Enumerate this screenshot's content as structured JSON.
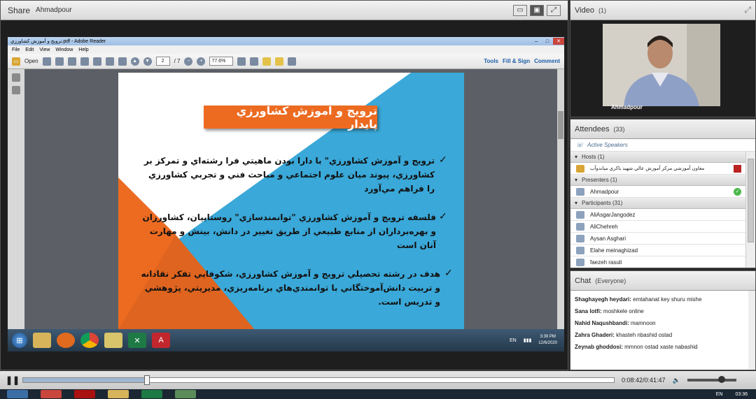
{
  "share": {
    "title": "Share",
    "presenter": "Ahmadpour"
  },
  "reader": {
    "window_title": "ترويج و آموزش كشاورزي.pdf - Adobe Reader",
    "menu": [
      "File",
      "Edit",
      "View",
      "Window",
      "Help"
    ],
    "open_label": "Open",
    "page_current": "2",
    "page_total": "/ 7",
    "zoom": "77.6%",
    "tools": "Tools",
    "fill_sign": "Fill & Sign",
    "comment": "Comment"
  },
  "slide": {
    "title": "ترويج و آموزش كشاورزي پايدار",
    "bullets": [
      "ترويج و آموزش كشاورزي\" با دارا بودن ماهيتي فرا رشته‌اي و تمركز بر كشاورزي، پيوند ميان علوم اجتماعي و مباحث فني و تجربي كشاورزي را فراهم مي‌آورد",
      "فلسفه ترويج و آموزش كشاورزي \"توانمندسازي\" روستاييان، كشاورزان و بهره‌برداران از منابع طبيعي از طريق تغيير در دانش، بينش و مهارت آنان است",
      "هدف در رشته تحصيلي ترويج و آموزش كشاورزي، شكوفايي تفكر نقادانه و تربيت دانش‌آموختگاني با توانمندي‌هاي برنامه‌ريزي، مديريتي، پژوهشي و تدريس است."
    ],
    "check": "✓",
    "colors": {
      "blue": "#3aa8d8",
      "white": "#ffffff",
      "orange": "#ec6b21",
      "title_bg": "#ec6b21"
    }
  },
  "guest_taskbar": {
    "lang": "EN",
    "time": "3:39 PM",
    "date": "12/6/2020"
  },
  "video": {
    "title": "Video",
    "count": "(1)",
    "name": "Ahmadpour"
  },
  "attendees": {
    "title": "Attendees",
    "count": "(33)",
    "active_speakers": "Active Speakers",
    "hosts_label": "Hosts (1)",
    "hosts": [
      "معاون آموزشي مركز آموزش عالي شهيد باكري مياندوآب"
    ],
    "presenters_label": "Presenters (1)",
    "presenters": [
      "Ahmadpour"
    ],
    "participants_label": "Participants (31)",
    "participants": [
      "AliAsgarJangodez",
      "AliChehreh",
      "Aysan Asghari",
      "Elahe meinaghizad",
      "faezeh rasuli"
    ]
  },
  "chat": {
    "title": "Chat",
    "scope": "(Everyone)",
    "messages": [
      {
        "sender": "Shaghayegh heydari:",
        "text": "emtahanat key shuru  mishe"
      },
      {
        "sender": "Sana lotfi:",
        "text": "moshkele online"
      },
      {
        "sender": "Nahid Naqushbandi:",
        "text": "mamnoon"
      },
      {
        "sender": "Zahra Ghaderi:",
        "text": "khasteh nbashid ostad"
      },
      {
        "sender": "Zeynab ghoddosi:",
        "text": "mmnon ostad xaste nabashid"
      }
    ]
  },
  "playback": {
    "time": "0:08:42/0:41:47",
    "progress": 0.21,
    "volume": 0.7
  },
  "host_taskbar": {
    "lang": "EN",
    "time": "03:36"
  }
}
